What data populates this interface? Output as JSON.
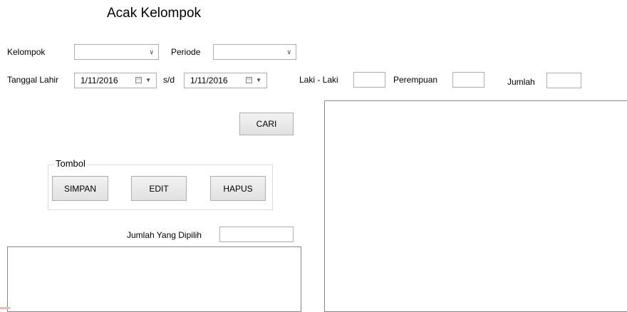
{
  "title": "Acak Kelompok",
  "filters": {
    "kelompok_label": "Kelompok",
    "kelompok_value": "",
    "periode_label": "Periode",
    "periode_value": "",
    "tanggal_lahir_label": "Tanggal Lahir",
    "date_from": "1/11/2016",
    "sd_label": "s/d",
    "date_to": "1/11/2016",
    "laki_label": "Laki - Laki",
    "laki_value": "",
    "perempuan_label": "Perempuan",
    "perempuan_value": "",
    "jumlah_label": "Jumlah",
    "jumlah_value": ""
  },
  "cari_button": "CARI",
  "tombol": {
    "label": "Tombol",
    "simpan": "SIMPAN",
    "edit": "EDIT",
    "hapus": "HAPUS"
  },
  "jumlah_dipilih": {
    "label": "Jumlah Yang Dipilih",
    "value": ""
  },
  "icons": {
    "dropdown": "chevron-down-icon",
    "calendar": "calendar-icon"
  }
}
